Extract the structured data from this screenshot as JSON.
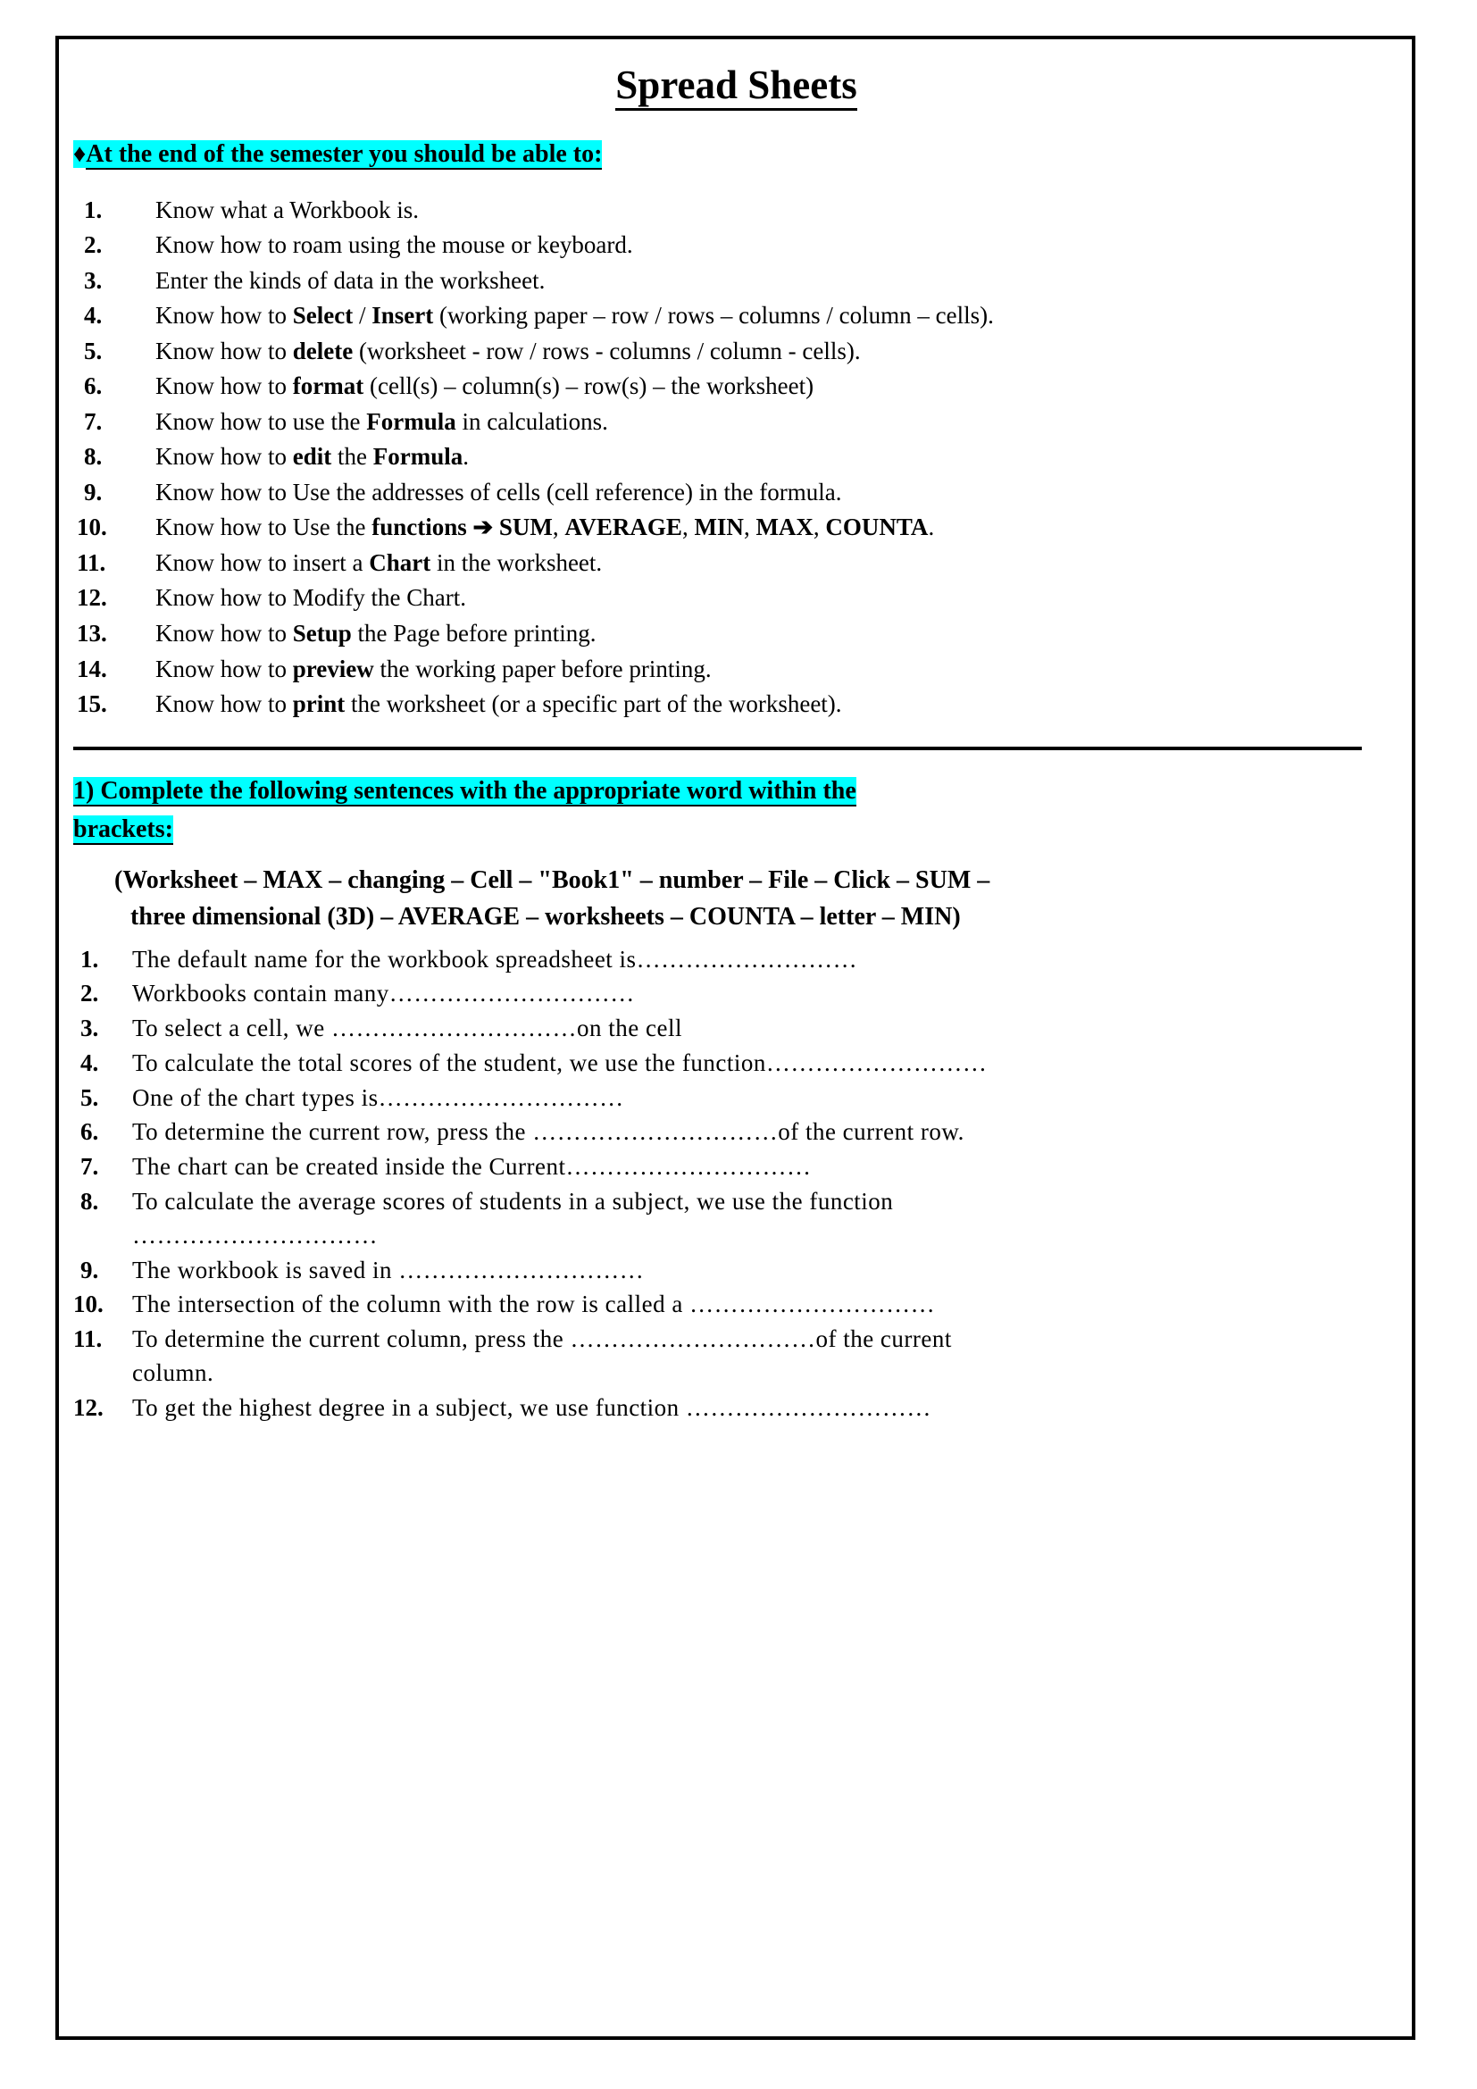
{
  "document": {
    "title": "Spread Sheets",
    "section1": {
      "bullet": "♦",
      "heading": "At the end of the semester you should be able to:",
      "highlight_color": "#00FFFF",
      "items": [
        {
          "num": "1.",
          "parts": [
            {
              "t": "Know what a Workbook is.",
              "b": false
            }
          ]
        },
        {
          "num": "2.",
          "parts": [
            {
              "t": "Know how to roam using the mouse or keyboard.",
              "b": false
            }
          ]
        },
        {
          "num": "3.",
          "parts": [
            {
              "t": "Enter the kinds of data in the worksheet.",
              "b": false
            }
          ]
        },
        {
          "num": "4.",
          "parts": [
            {
              "t": "Know how to ",
              "b": false
            },
            {
              "t": "Select",
              "b": true
            },
            {
              "t": " / ",
              "b": false
            },
            {
              "t": "Insert",
              "b": true
            },
            {
              "t": " (working paper – row / rows – columns / column – cells).",
              "b": false
            }
          ]
        },
        {
          "num": "5.",
          "parts": [
            {
              "t": "Know how to ",
              "b": false
            },
            {
              "t": "delete",
              "b": true
            },
            {
              "t": " (worksheet - row / rows - columns / column - cells).",
              "b": false
            }
          ]
        },
        {
          "num": "6.",
          "parts": [
            {
              "t": "Know how to ",
              "b": false
            },
            {
              "t": "format",
              "b": true
            },
            {
              "t": " (cell(s) – column(s) – row(s) – the worksheet)",
              "b": false
            }
          ]
        },
        {
          "num": "7.",
          "parts": [
            {
              "t": "Know how to use the ",
              "b": false
            },
            {
              "t": "Formula",
              "b": true
            },
            {
              "t": " in calculations.",
              "b": false
            }
          ]
        },
        {
          "num": "8.",
          "parts": [
            {
              "t": "Know how to ",
              "b": false
            },
            {
              "t": "edit",
              "b": true
            },
            {
              "t": " the ",
              "b": false
            },
            {
              "t": "Formula",
              "b": true
            },
            {
              "t": ".",
              "b": false
            }
          ]
        },
        {
          "num": "9.",
          "parts": [
            {
              "t": "Know how to Use the addresses of cells (cell reference) in the formula.",
              "b": false
            }
          ]
        },
        {
          "num": "10.",
          "parts": [
            {
              "t": "Know how to Use the ",
              "b": false
            },
            {
              "t": "functions",
              "b": true
            },
            {
              "t": " ➔  ",
              "b": true
            },
            {
              "t": "SUM",
              "b": true
            },
            {
              "t": ", ",
              "b": false
            },
            {
              "t": "AVERAGE",
              "b": true
            },
            {
              "t": ", ",
              "b": false
            },
            {
              "t": "MIN",
              "b": true
            },
            {
              "t": ", ",
              "b": false
            },
            {
              "t": "MAX",
              "b": true
            },
            {
              "t": ", ",
              "b": false
            },
            {
              "t": "COUNTA",
              "b": true
            },
            {
              "t": ".",
              "b": false
            }
          ]
        },
        {
          "num": "11.",
          "parts": [
            {
              "t": "Know how to insert a ",
              "b": false
            },
            {
              "t": "Chart",
              "b": true
            },
            {
              "t": " in the worksheet.",
              "b": false
            }
          ]
        },
        {
          "num": "12.",
          "parts": [
            {
              "t": "Know how to Modify the Chart.",
              "b": false
            }
          ]
        },
        {
          "num": "13.",
          "parts": [
            {
              "t": "Know how to ",
              "b": false
            },
            {
              "t": "Setup",
              "b": true
            },
            {
              "t": " the Page before printing.",
              "b": false
            }
          ]
        },
        {
          "num": "14.",
          "parts": [
            {
              "t": "Know how to ",
              "b": false
            },
            {
              "t": "preview",
              "b": true
            },
            {
              "t": " the working paper before printing.",
              "b": false
            }
          ]
        },
        {
          "num": "15.",
          "parts": [
            {
              "t": "Know how to ",
              "b": false
            },
            {
              "t": "print",
              "b": true
            },
            {
              "t": " the worksheet (or a specific part of the worksheet).",
              "b": false
            }
          ]
        }
      ]
    },
    "section2": {
      "heading_line1": "1) Complete the following sentences with the appropriate word within the",
      "heading_line2": "brackets:",
      "highlight_color": "#00FFFF",
      "word_bank_line1": "(Worksheet – MAX – changing – Cell – \"Book1\" – number – File – Click – SUM –",
      "word_bank_line2": "three dimensional (3D) – AVERAGE – worksheets – COUNTA – letter – MIN)",
      "questions": [
        {
          "num": "1.",
          "text": "The default name for the workbook spreadsheet is………………………",
          "cont": ""
        },
        {
          "num": "2.",
          "text": "Workbooks contain many…………………………",
          "cont": ""
        },
        {
          "num": "3.",
          "text": "To select a cell, we …………………………on the cell",
          "cont": ""
        },
        {
          "num": "4.",
          "text": "To calculate the total scores of the student, we use the function………………………",
          "cont": ""
        },
        {
          "num": "5.",
          "text": "One of the chart types is…………………………",
          "cont": ""
        },
        {
          "num": "6.",
          "text": " To determine the current row, press the …………………………of the current row.",
          "cont": ""
        },
        {
          "num": "7.",
          "text": "The chart can be created inside the Current…………………………",
          "cont": ""
        },
        {
          "num": "8.",
          "text": "To calculate the average scores of students in a subject, we use the function",
          "cont": "…………………………"
        },
        {
          "num": "9.",
          "text": "The workbook is saved in …………………………",
          "cont": ""
        },
        {
          "num": "10.",
          "text": "The intersection of the column with the row is called a …………………………",
          "cont": ""
        },
        {
          "num": "11.",
          "text": "To determine the current column, press the …………………………of the current",
          "cont": "column."
        },
        {
          "num": "12.",
          "text": "To get the highest degree in a subject, we use function …………………………",
          "cont": ""
        }
      ]
    }
  }
}
